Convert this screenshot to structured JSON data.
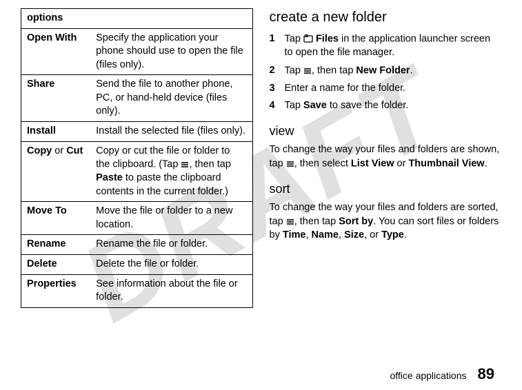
{
  "watermark": "DRAFT",
  "table": {
    "header": "options",
    "rows": [
      {
        "label": "Open With",
        "desc": "Specify the application your phone should use to open the file (files only)."
      },
      {
        "label": "Share",
        "desc": "Send the file to another phone, PC, or hand-held device (files only)."
      },
      {
        "label": "Install",
        "desc": "Install the selected file (files only)."
      },
      {
        "label": "Copy",
        "label_mid": " or ",
        "label2": "Cut",
        "desc_pre": "Copy or cut the file or folder to the clipboard. (Tap ",
        "desc_post_menu": ", then tap ",
        "desc_bold": "Paste",
        "desc_tail": " to paste the clipboard contents in the current folder.)"
      },
      {
        "label": "Move To",
        "desc": "Move the file or folder to a new location."
      },
      {
        "label": "Rename",
        "desc": "Rename the file or folder."
      },
      {
        "label": "Delete",
        "desc": "Delete the file or folder."
      },
      {
        "label": "Properties",
        "desc": "See information about the file or folder."
      }
    ]
  },
  "right": {
    "h_create": "create a new folder",
    "steps": [
      {
        "n": "1",
        "pre": "Tap ",
        "icon": "card",
        "bold": "Files",
        "post": " in the application launcher screen to open the file manager."
      },
      {
        "n": "2",
        "pre": "Tap ",
        "icon": "menu",
        "mid": ", then tap ",
        "bold": "New Folder",
        "post": "."
      },
      {
        "n": "3",
        "pre": "Enter a name for the folder.",
        "bold": "",
        "post": ""
      },
      {
        "n": "4",
        "pre": "Tap ",
        "bold": "Save",
        "post": " to save the folder."
      }
    ],
    "h_view": "view",
    "view_pre": "To change the way your files and folders are shown, tap ",
    "view_mid": ", then select ",
    "view_b1": "List View",
    "view_or": " or ",
    "view_b2": "Thumbnail View",
    "view_post": ".",
    "h_sort": "sort",
    "sort_pre": "To change the way your files and folders are sorted, tap ",
    "sort_mid": ", then tap ",
    "sort_b1": "Sort by",
    "sort_post1": ". You can sort files or folders by ",
    "sort_t1": "Time",
    "sort_c": ", ",
    "sort_t2": "Name",
    "sort_t3": "Size",
    "sort_or": ", or ",
    "sort_t4": "Type",
    "sort_end": "."
  },
  "footer": {
    "label": "office applications",
    "page": "89"
  }
}
